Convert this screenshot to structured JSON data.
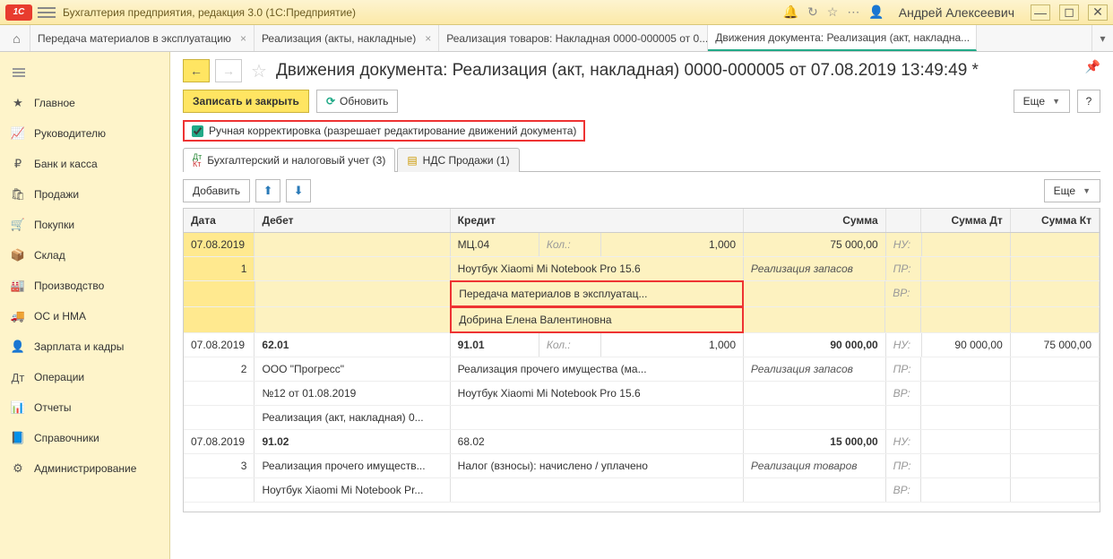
{
  "app": {
    "title": "Бухгалтерия предприятия, редакция 3.0  (1С:Предприятие)",
    "user": "Андрей Алексеевич"
  },
  "tabs": [
    {
      "label": "Передача материалов в эксплуатацию"
    },
    {
      "label": "Реализация (акты, накладные)"
    },
    {
      "label": "Реализация товаров: Накладная 0000-000005 от 0..."
    },
    {
      "label": "Движения документа: Реализация (акт, накладна..."
    }
  ],
  "sidebar": [
    {
      "icon": "★",
      "label": "Главное"
    },
    {
      "icon": "📈",
      "label": "Руководителю"
    },
    {
      "icon": "₽",
      "label": "Банк и касса"
    },
    {
      "icon": "🛍",
      "label": "Продажи"
    },
    {
      "icon": "🛒",
      "label": "Покупки"
    },
    {
      "icon": "📦",
      "label": "Склад"
    },
    {
      "icon": "🏭",
      "label": "Производство"
    },
    {
      "icon": "🚚",
      "label": "ОС и НМА"
    },
    {
      "icon": "👤",
      "label": "Зарплата и кадры"
    },
    {
      "icon": "Дт",
      "label": "Операции"
    },
    {
      "icon": "📊",
      "label": "Отчеты"
    },
    {
      "icon": "📘",
      "label": "Справочники"
    },
    {
      "icon": "⚙",
      "label": "Администрирование"
    }
  ],
  "page": {
    "title": "Движения документа: Реализация (акт, накладная) 0000-000005 от 07.08.2019 13:49:49 *",
    "save_close": "Записать и закрыть",
    "refresh": "Обновить",
    "more": "Еще",
    "help": "?",
    "manual_edit": "Ручная корректировка (разрешает редактирование движений документа)",
    "add": "Добавить"
  },
  "subtabs": [
    {
      "label": "Бухгалтерский и налоговый учет (3)"
    },
    {
      "label": "НДС Продажи (1)"
    }
  ],
  "columns": {
    "date": "Дата",
    "debit": "Дебет",
    "credit": "Кредит",
    "sum": "Сумма",
    "sum_dt": "Сумма Дт",
    "sum_kt": "Сумма Кт"
  },
  "rows": [
    {
      "highlight": true,
      "lines": [
        {
          "date": "07.08.2019",
          "deb": "",
          "kr": "МЦ.04",
          "kr2": "Кол.:",
          "kr3": "1,000",
          "sum": "75 000,00",
          "lbl": "НУ:",
          "sdt": "",
          "skt": ""
        },
        {
          "date": "1",
          "num": true,
          "deb": "",
          "kr": "Ноутбук Xiaomi Mi Notebook Pro 15.6",
          "sum": "Реализация запасов",
          "italic": true,
          "lbl": "ПР:"
        },
        {
          "deb": "",
          "kr": "Передача материалов в эксплуатац...",
          "lbl": "ВР:",
          "red": true
        },
        {
          "deb": "",
          "kr": "Добрина Елена Валентиновна",
          "red": true
        }
      ]
    },
    {
      "lines": [
        {
          "date": "07.08.2019",
          "deb": "62.01",
          "kr": "91.01",
          "kr2": "Кол.:",
          "kr3": "1,000",
          "sum": "90 000,00",
          "lbl": "НУ:",
          "sdt": "90 000,00",
          "skt": "75 000,00",
          "bold": true
        },
        {
          "date": "2",
          "num": true,
          "deb": "ООО \"Прогресс\"",
          "kr": "Реализация прочего имущества (ма...",
          "sum": "Реализация запасов",
          "italic": true,
          "lbl": "ПР:"
        },
        {
          "deb": "№12 от 01.08.2019",
          "kr": "Ноутбук Xiaomi Mi Notebook Pro 15.6",
          "lbl": "ВР:"
        },
        {
          "deb": "Реализация (акт, накладная) 0..."
        }
      ]
    },
    {
      "lines": [
        {
          "date": "07.08.2019",
          "deb": "91.02",
          "kr": "68.02",
          "sum": "15 000,00",
          "lbl": "НУ:",
          "bold": true
        },
        {
          "date": "3",
          "num": true,
          "deb": "Реализация прочего имуществ...",
          "kr": "Налог (взносы): начислено / уплачено",
          "sum": "Реализация товаров",
          "italic": true,
          "lbl": "ПР:"
        },
        {
          "deb": "Ноутбук Xiaomi Mi Notebook Pr...",
          "lbl": "ВР:"
        }
      ]
    }
  ]
}
